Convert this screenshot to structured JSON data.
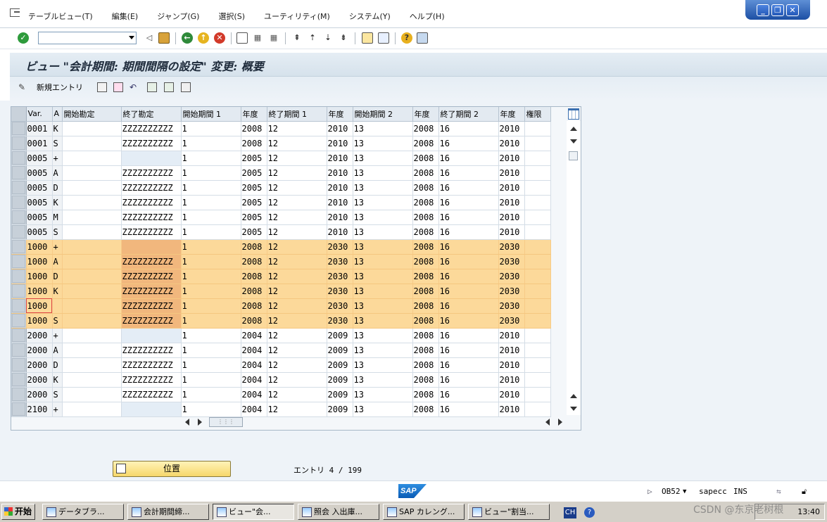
{
  "menu": {
    "items": [
      "テーブルビュー(T)",
      "編集(E)",
      "ジャンプ(G)",
      "選択(S)",
      "ユーティリティ(M)",
      "システム(Y)",
      "ヘルプ(H)"
    ]
  },
  "window_buttons": [
    "_",
    "❐",
    "✕"
  ],
  "page": {
    "title": "ビュー \"会計期間: 期間間隔の設定\" 変更: 概要"
  },
  "appbar": {
    "new_entries_label": "新規エントリ"
  },
  "table": {
    "headers": [
      "Var.",
      "A",
      "開始勘定",
      "終了勘定",
      "開始期間 1",
      "年度",
      "終了期間 1",
      "年度",
      "開始期間 2",
      "年度",
      "終了期間 2",
      "年度",
      "権限"
    ],
    "rows": [
      [
        "0001",
        "K",
        "",
        "ZZZZZZZZZZ",
        "1",
        "2008",
        "12",
        "2010",
        "13",
        "2008",
        "16",
        "2010",
        ""
      ],
      [
        "0001",
        "S",
        "",
        "ZZZZZZZZZZ",
        "1",
        "2008",
        "12",
        "2010",
        "13",
        "2008",
        "16",
        "2010",
        ""
      ],
      [
        "0005",
        "+",
        "",
        "",
        "1",
        "2005",
        "12",
        "2010",
        "13",
        "2008",
        "16",
        "2010",
        ""
      ],
      [
        "0005",
        "A",
        "",
        "ZZZZZZZZZZ",
        "1",
        "2005",
        "12",
        "2010",
        "13",
        "2008",
        "16",
        "2010",
        ""
      ],
      [
        "0005",
        "D",
        "",
        "ZZZZZZZZZZ",
        "1",
        "2005",
        "12",
        "2010",
        "13",
        "2008",
        "16",
        "2010",
        ""
      ],
      [
        "0005",
        "K",
        "",
        "ZZZZZZZZZZ",
        "1",
        "2005",
        "12",
        "2010",
        "13",
        "2008",
        "16",
        "2010",
        ""
      ],
      [
        "0005",
        "M",
        "",
        "ZZZZZZZZZZ",
        "1",
        "2005",
        "12",
        "2010",
        "13",
        "2008",
        "16",
        "2010",
        ""
      ],
      [
        "0005",
        "S",
        "",
        "ZZZZZZZZZZ",
        "1",
        "2005",
        "12",
        "2010",
        "13",
        "2008",
        "16",
        "2010",
        ""
      ],
      [
        "1000",
        "+",
        "",
        "",
        "1",
        "2008",
        "12",
        "2030",
        "13",
        "2008",
        "16",
        "2030",
        ""
      ],
      [
        "1000",
        "A",
        "",
        "ZZZZZZZZZZ",
        "1",
        "2008",
        "12",
        "2030",
        "13",
        "2008",
        "16",
        "2030",
        ""
      ],
      [
        "1000",
        "D",
        "",
        "ZZZZZZZZZZ",
        "1",
        "2008",
        "12",
        "2030",
        "13",
        "2008",
        "16",
        "2030",
        ""
      ],
      [
        "1000",
        "K",
        "",
        "ZZZZZZZZZZ",
        "1",
        "2008",
        "12",
        "2030",
        "13",
        "2008",
        "16",
        "2030",
        ""
      ],
      [
        "1000",
        "",
        "",
        "ZZZZZZZZZZ",
        "1",
        "2008",
        "12",
        "2030",
        "13",
        "2008",
        "16",
        "2030",
        ""
      ],
      [
        "1000",
        "S",
        "",
        "ZZZZZZZZZZ",
        "1",
        "2008",
        "12",
        "2030",
        "13",
        "2008",
        "16",
        "2030",
        ""
      ],
      [
        "2000",
        "+",
        "",
        "",
        "1",
        "2004",
        "12",
        "2009",
        "13",
        "2008",
        "16",
        "2010",
        ""
      ],
      [
        "2000",
        "A",
        "",
        "ZZZZZZZZZZ",
        "1",
        "2004",
        "12",
        "2009",
        "13",
        "2008",
        "16",
        "2010",
        ""
      ],
      [
        "2000",
        "D",
        "",
        "ZZZZZZZZZZ",
        "1",
        "2004",
        "12",
        "2009",
        "13",
        "2008",
        "16",
        "2010",
        ""
      ],
      [
        "2000",
        "K",
        "",
        "ZZZZZZZZZZ",
        "1",
        "2004",
        "12",
        "2009",
        "13",
        "2008",
        "16",
        "2010",
        ""
      ],
      [
        "2000",
        "S",
        "",
        "ZZZZZZZZZZ",
        "1",
        "2004",
        "12",
        "2009",
        "13",
        "2008",
        "16",
        "2010",
        ""
      ],
      [
        "2100",
        "+",
        "",
        "",
        "1",
        "2004",
        "12",
        "2009",
        "13",
        "2008",
        "16",
        "2010",
        ""
      ]
    ],
    "highlighted_rows": [
      8,
      9,
      10,
      11,
      12,
      13
    ],
    "current_row": 12
  },
  "position_button": {
    "label": "位置"
  },
  "entry_count": "エントリ 4 / 199",
  "status": {
    "transaction": "OB52",
    "system": "sapecc",
    "mode": "INS"
  },
  "taskbar": {
    "start": "开始",
    "tasks": [
      "データブラ...",
      "会計期間締...",
      "ビュー\"会...",
      "照会 入出庫...",
      "SAP カレング...",
      "ビュー\"割当..."
    ],
    "active_task": 2,
    "lang": "CH",
    "clock": "13:40"
  },
  "watermark": "CSDN @东京老树根",
  "colors": {
    "highlight_row": "#fcd99a",
    "highlight_dark": "#f1b77d",
    "title_bg": "#d6e2ec",
    "position_button": "#f6d76a"
  }
}
